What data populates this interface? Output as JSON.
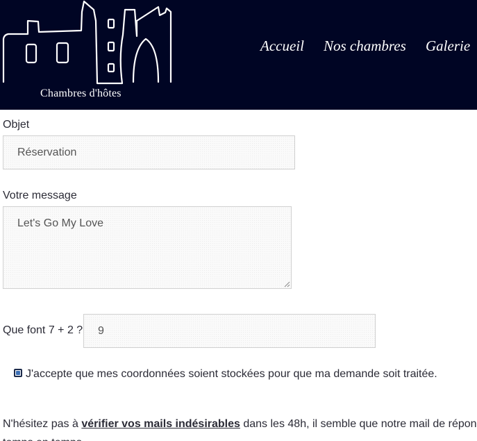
{
  "header": {
    "logo_text": "Chambres d'hôtes",
    "nav": [
      {
        "label": "Accueil"
      },
      {
        "label": "Nos chambres"
      },
      {
        "label": "Galerie"
      }
    ],
    "background_color": "#000524"
  },
  "form": {
    "objet": {
      "label": "Objet",
      "value": "Réservation"
    },
    "message": {
      "label": "Votre message",
      "value": "Let's Go My Love"
    },
    "captcha": {
      "label": "Que font 7 + 2 ?",
      "value": "9"
    },
    "consent": {
      "checked": true,
      "text": "J'accepte que mes coordonnées soient stockées pour que ma demande soit traitée."
    }
  },
  "notice": {
    "prefix": "N'hésitez pas à ",
    "link": "vérifier vos mails indésirables",
    "suffix": " dans les 48h, il semble que notre mail de répon",
    "line2": "temps en temps."
  }
}
